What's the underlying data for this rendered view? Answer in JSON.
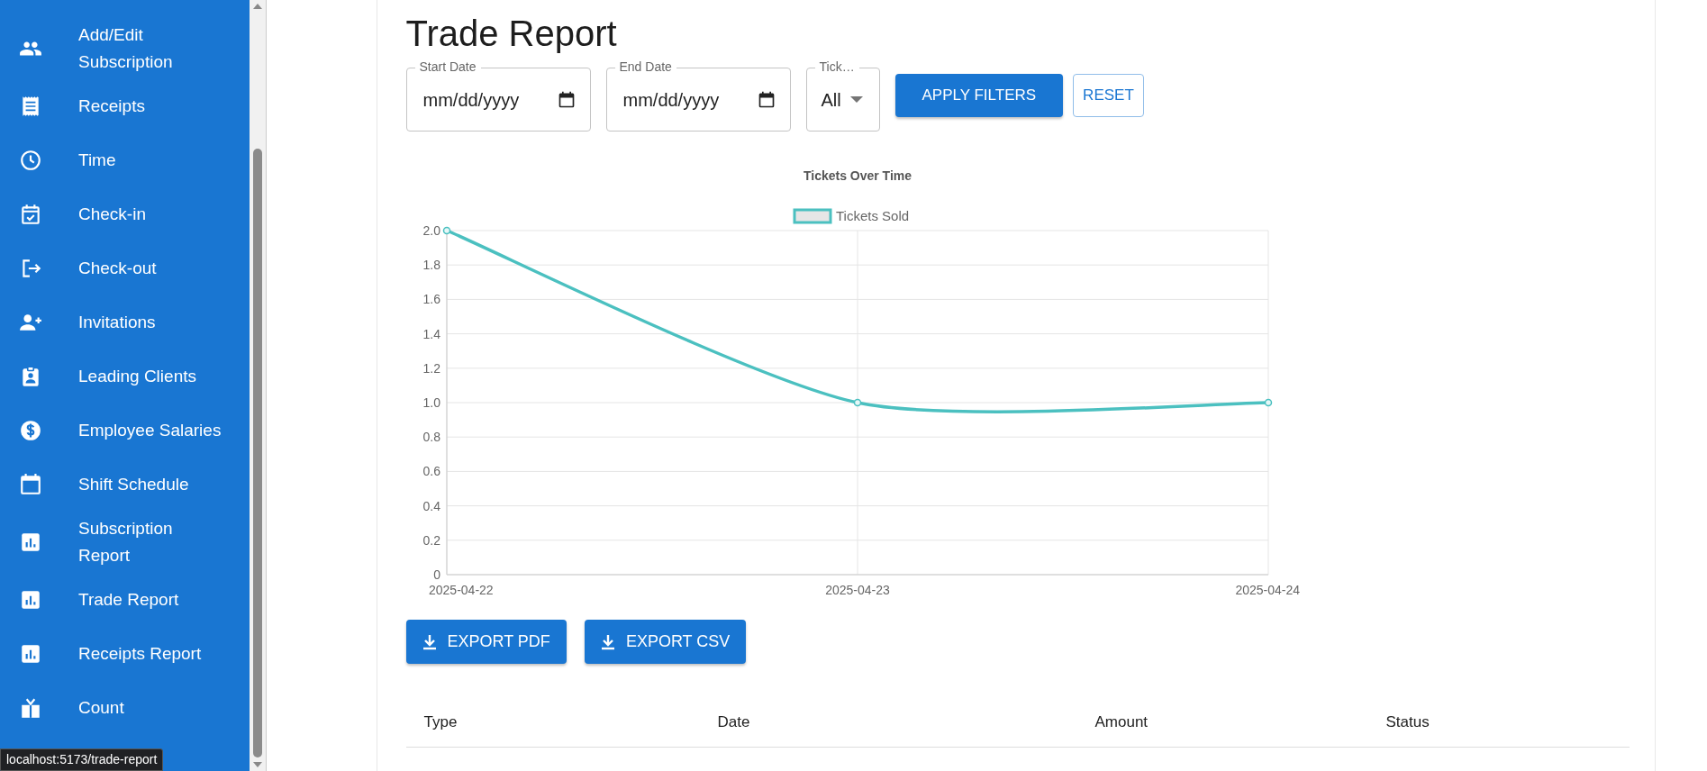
{
  "sidebar": {
    "items": [
      {
        "label": "Add/Edit Subscription"
      },
      {
        "label": "Receipts"
      },
      {
        "label": "Time"
      },
      {
        "label": "Check-in"
      },
      {
        "label": "Check-out"
      },
      {
        "label": "Invitations"
      },
      {
        "label": "Leading Clients"
      },
      {
        "label": "Employee Salaries"
      },
      {
        "label": "Shift Schedule"
      },
      {
        "label": "Subscription Report"
      },
      {
        "label": "Trade Report"
      },
      {
        "label": "Receipts Report"
      },
      {
        "label": "Count"
      }
    ]
  },
  "status_url": "localhost:5173/trade-report",
  "page_title": "Trade Report",
  "filters": [
    {
      "kind": "date",
      "label": "Start Date",
      "placeholder": "mm/dd/yyyy"
    },
    {
      "kind": "date",
      "label": "End Date",
      "placeholder": "mm/dd/yyyy"
    },
    {
      "kind": "select",
      "label": "Tick…",
      "value": "All"
    }
  ],
  "filter_buttons": [
    {
      "label": "APPLY FILTERS",
      "kind": "primary"
    },
    {
      "label": "RESET",
      "kind": "outline"
    }
  ],
  "chart": {
    "chart_data": {
      "type": "line",
      "title": "Tickets Over Time",
      "categories": [
        "2025-04-22",
        "2025-04-23",
        "2025-04-24"
      ],
      "series": [
        {
          "name": "Tickets Sold",
          "color": "#4bc0c0",
          "marker": true,
          "values": [
            2,
            1,
            1
          ]
        }
      ],
      "grid": true,
      "ylim": [
        0,
        2
      ],
      "yticks": [
        {
          "value": 0,
          "label": "0"
        },
        {
          "value": 0.2,
          "label": "0.2"
        },
        {
          "value": 0.4,
          "label": "0.4"
        },
        {
          "value": 0.6,
          "label": "0.6"
        },
        {
          "value": 0.8,
          "label": "0.8"
        },
        {
          "value": 1,
          "label": "1.0"
        },
        {
          "value": 1.2,
          "label": "1.2"
        },
        {
          "value": 1.4,
          "label": "1.4"
        },
        {
          "value": 1.6,
          "label": "1.6"
        },
        {
          "value": 1.8,
          "label": "1.8"
        },
        {
          "value": 2,
          "label": "2.0"
        }
      ]
    }
  },
  "export_buttons": [
    "EXPORT PDF",
    "EXPORT CSV"
  ],
  "table": {
    "columns": [
      "Type",
      "Date",
      "Amount",
      "Status"
    ]
  }
}
